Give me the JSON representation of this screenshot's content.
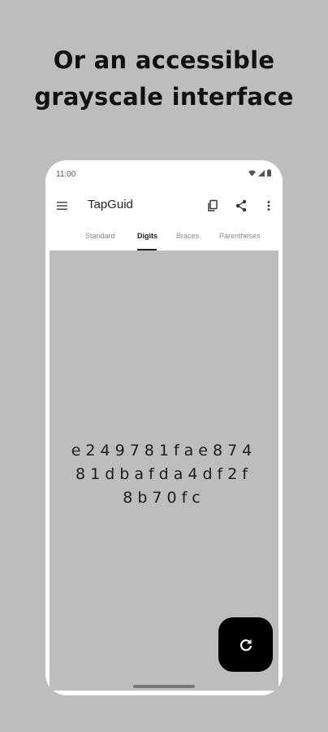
{
  "headline": {
    "line1": "Or an accessible",
    "line2": "grayscale interface"
  },
  "status_bar": {
    "time": "11:00",
    "icons": [
      "wifi-icon",
      "signal-icon",
      "battery-icon"
    ]
  },
  "app_bar": {
    "title": "TapGuid",
    "menu_icon": "menu-icon",
    "actions": [
      "copy-icon",
      "share-icon",
      "more-vert-icon"
    ]
  },
  "tabs": [
    {
      "label": "Standard",
      "active": false
    },
    {
      "label": "Digits",
      "active": true
    },
    {
      "label": "Braces",
      "active": false
    },
    {
      "label": "Parentheses",
      "active": false
    }
  ],
  "guid_display": {
    "line1": "e249781faе874",
    "line2": "81dbafda4df2f",
    "line3": "8b70fc"
  },
  "fab": {
    "icon": "refresh-icon"
  },
  "colors": {
    "background": "#bdbdbd",
    "surface": "#ffffff",
    "text": "#222222",
    "fab": "#000000"
  }
}
